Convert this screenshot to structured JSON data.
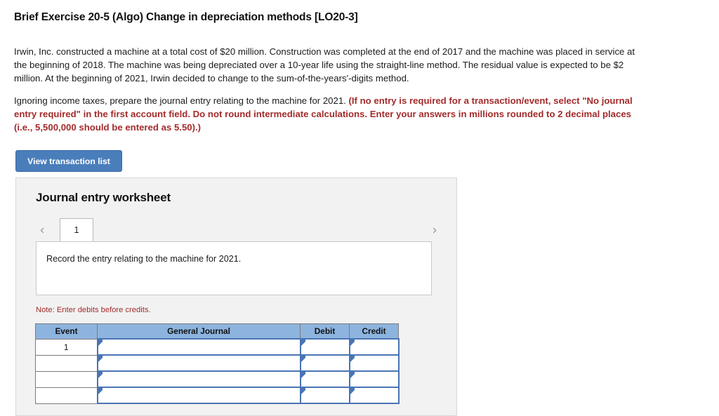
{
  "page_title": "Brief Exercise 20-5 (Algo) Change in depreciation methods [LO20-3]",
  "prompt": {
    "paragraph_1": "Irwin, Inc. constructed a machine at a total cost of $20 million. Construction was completed at the end of 2017 and the machine was placed in service at the beginning of 2018. The machine was being depreciated over a 10-year life using the straight-line method. The residual value is expected to be $2 million. At the beginning of 2021, Irwin decided to change to the sum-of-the-years'-digits method.",
    "paragraph_2_lead": "Ignoring income taxes, prepare the journal entry relating to the machine for 2021. ",
    "paragraph_2_emphasis": "(If no entry is required for a transaction/event, select \"No journal entry required\" in the first account field. Do not round intermediate calculations. Enter your answers in millions rounded to 2 decimal places (i.e., 5,500,000 should be entered as 5.50).)"
  },
  "view_transaction_button": "View transaction list",
  "worksheet": {
    "title": "Journal entry worksheet",
    "prev_icon": "chevron-left-icon",
    "next_icon": "chevron-right-icon",
    "tabs": [
      {
        "label": "1",
        "active": true
      }
    ],
    "instruction": "Record the entry relating to the machine for 2021.",
    "note": "Note: Enter debits before credits."
  },
  "journal_table": {
    "columns": [
      "Event",
      "General Journal",
      "Debit",
      "Credit"
    ],
    "rows": [
      {
        "event": "1",
        "general_journal": "",
        "debit": "",
        "credit": ""
      },
      {
        "event": "",
        "general_journal": "",
        "debit": "",
        "credit": ""
      },
      {
        "event": "",
        "general_journal": "",
        "debit": "",
        "credit": ""
      },
      {
        "event": "",
        "general_journal": "",
        "debit": "",
        "credit": ""
      }
    ]
  },
  "colors": {
    "button_blue": "#4a7ebb",
    "table_header_blue": "#8db4de",
    "input_border_blue": "#4a74b5",
    "emphasis_red": "#a32b2b",
    "panel_gray": "#f2f2f2"
  }
}
